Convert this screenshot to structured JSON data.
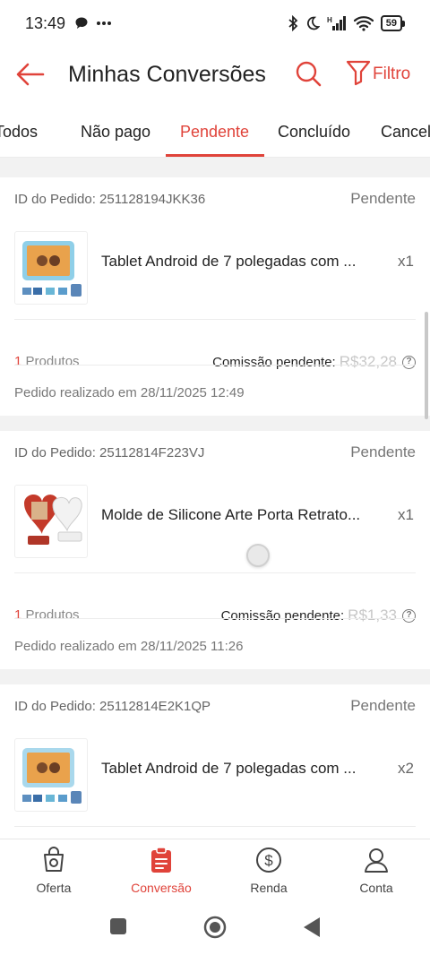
{
  "status_bar": {
    "time": "13:49",
    "battery": "59"
  },
  "header": {
    "title": "Minhas Conversões",
    "filter_label": "Filtro"
  },
  "tabs": [
    {
      "label": "Todos",
      "active": false
    },
    {
      "label": "Não pago",
      "active": false
    },
    {
      "label": "Pendente",
      "active": true
    },
    {
      "label": "Concluído",
      "active": false
    },
    {
      "label": "Cancel",
      "active": false
    }
  ],
  "orders": [
    {
      "id_label": "ID do Pedido: 251128194JKK36",
      "status": "Pendente",
      "product_name": "Tablet Android de 7 polegadas com ...",
      "quantity": "x1",
      "products_count": "1",
      "products_label": "Produtos",
      "commission_label": "Comissão pendente:",
      "commission_value": "R$32,28",
      "date": "Pedido realizado em 28/11/2025 12:49"
    },
    {
      "id_label": "ID do Pedido: 25112814F223VJ",
      "status": "Pendente",
      "product_name": "Molde de Silicone Arte Porta Retrato...",
      "quantity": "x1",
      "products_count": "1",
      "products_label": "Produtos",
      "commission_label": "Comissão pendente:",
      "commission_value": "R$1,33",
      "date": "Pedido realizado em 28/11/2025 11:26"
    },
    {
      "id_label": "ID do Pedido: 25112814E2K1QP",
      "status": "Pendente",
      "product_name": "Tablet Android de 7 polegadas com ...",
      "quantity": "x2"
    }
  ],
  "bottom_nav": [
    {
      "label": "Oferta",
      "icon": "offer-icon",
      "active": false
    },
    {
      "label": "Conversão",
      "icon": "conversion-icon",
      "active": true
    },
    {
      "label": "Renda",
      "icon": "income-icon",
      "active": false
    },
    {
      "label": "Conta",
      "icon": "account-icon",
      "active": false
    }
  ],
  "colors": {
    "accent": "#e0433a",
    "muted_value": "#c7c7c7"
  }
}
